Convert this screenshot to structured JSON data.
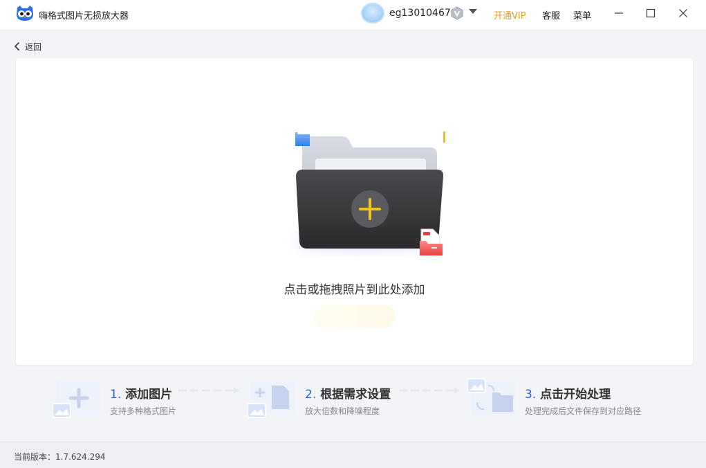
{
  "app": {
    "title": "嗨格式图片无损放大器",
    "icon": "owl-logo-icon"
  },
  "user": {
    "name": "eg13010467",
    "badge_icon": "vip-badge-icon",
    "dropdown_icon": "caret-down-icon"
  },
  "top_menu": {
    "open_vip": "开通VIP",
    "service": "客服",
    "menu": "菜单"
  },
  "window_controls": [
    "minimize-icon",
    "maximize-icon",
    "close-icon"
  ],
  "back": {
    "label": "返回",
    "icon": "chevron-left-icon"
  },
  "upload": {
    "prompt": "点击或拖拽照片到此处添加",
    "icon": "folder-add-icon"
  },
  "steps": [
    {
      "number": "1.",
      "title": "添加图片",
      "desc": "支持多种格式图片",
      "icon": "add-image-icon"
    },
    {
      "number": "2.",
      "title": "根据需求设置",
      "desc": "放大倍数和降噪程度",
      "icon": "settings-image-icon"
    },
    {
      "number": "3.",
      "title": "点击开始处理",
      "desc": "处理完成后文件保存到对应路径",
      "icon": "process-image-icon"
    }
  ],
  "status": {
    "version": "当前版本：1.7.624.294"
  },
  "colors": {
    "accent_vip": "#e8a012",
    "step_number": "#2a5fd4",
    "plus": "#f6c21c"
  }
}
